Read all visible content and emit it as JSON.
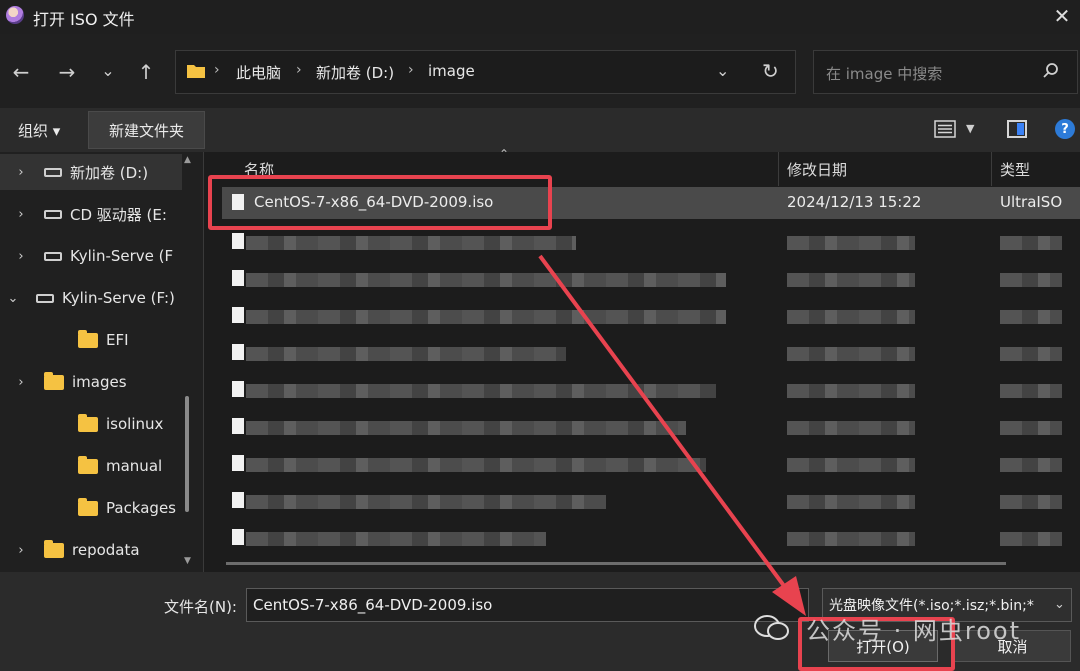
{
  "window": {
    "title": "打开 ISO 文件",
    "close_glyph": "✕"
  },
  "nav": {
    "back_glyph": "←",
    "forward_glyph": "→",
    "recent_glyph": "⌄",
    "up_glyph": "↑",
    "breadcrumbs": [
      "此电脑",
      "新加卷 (D:)",
      "image"
    ],
    "crumb_sep": "›",
    "dropdown_glyph": "⌄",
    "refresh_glyph": "↻",
    "search_placeholder": "在 image 中搜索"
  },
  "toolbar": {
    "organize_label": "组织 ▾",
    "new_folder_label": "新建文件夹",
    "help_glyph": "?"
  },
  "tree": [
    {
      "label": "新加卷 (D:)",
      "type": "drive",
      "chevron": "›",
      "selected": true
    },
    {
      "label": "CD 驱动器 (E:",
      "type": "drive",
      "chevron": "›"
    },
    {
      "label": "Kylin-Serve (F",
      "type": "drive",
      "chevron": "›"
    },
    {
      "label": "Kylin-Serve (F:)",
      "type": "drive",
      "chevron": "⌄"
    },
    {
      "label": "EFI",
      "type": "folder",
      "chevron": ""
    },
    {
      "label": "images",
      "type": "folder",
      "chevron": "›"
    },
    {
      "label": "isolinux",
      "type": "folder",
      "chevron": ""
    },
    {
      "label": "manual",
      "type": "folder",
      "chevron": ""
    },
    {
      "label": "Packages",
      "type": "folder",
      "chevron": ""
    },
    {
      "label": "repodata",
      "type": "folder",
      "chevron": "›"
    }
  ],
  "columns": {
    "name": "名称",
    "modified": "修改日期",
    "type": "类型",
    "sort_glyph": "⌃"
  },
  "selected_file": {
    "name": "CentOS-7-x86_64-DVD-2009.iso",
    "modified": "2024/12/13 15:22",
    "type": "UltraISO"
  },
  "bottom": {
    "filename_label": "文件名(N):",
    "filename_value": "CentOS-7-x86_64-DVD-2009.iso",
    "filetype_value": "光盘映像文件(*.iso;*.isz;*.bin;*",
    "open_label": "打开(O)",
    "cancel_label": "取消",
    "dropdown_glyph": "⌄"
  },
  "watermark": "公众号 · 网虫root",
  "colors": {
    "annotation_red": "#e8434f",
    "folder_yellow": "#f5c242",
    "help_blue": "#2d7bd8"
  }
}
